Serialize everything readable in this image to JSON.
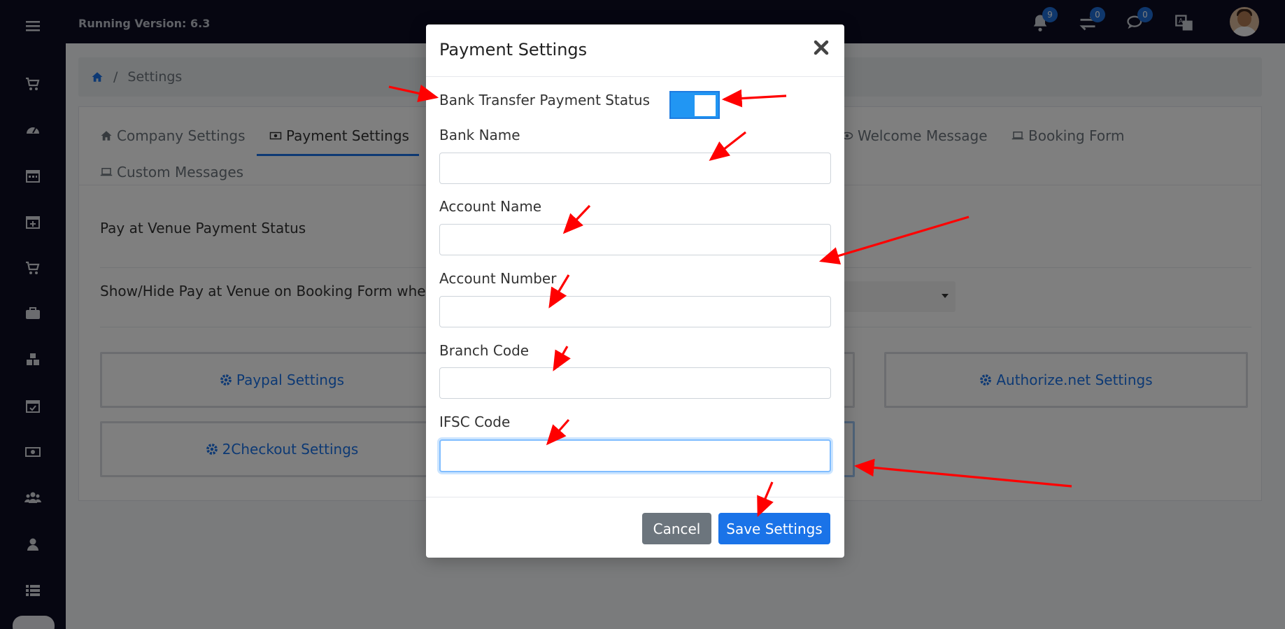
{
  "topbar": {
    "version": "Running Version: 6.3",
    "icons": [
      {
        "name": "notifications-icon",
        "badge": "9"
      },
      {
        "name": "transfer-icon",
        "badge": "0"
      },
      {
        "name": "messages-icon",
        "badge": "0"
      },
      {
        "name": "translate-icon",
        "badge": ""
      }
    ]
  },
  "sidebar": {
    "items": [
      "menu-icon",
      "cart-icon",
      "dashboard-icon",
      "calendar-icon",
      "calendar-plus-icon",
      "cart-icon",
      "briefcase-icon",
      "cubes-icon",
      "calendar-check-icon",
      "money-icon",
      "users-icon",
      "user-icon",
      "list-icon"
    ]
  },
  "breadcrumb": {
    "current": "Settings"
  },
  "tabs": [
    {
      "label": "Company Settings",
      "icon": "home-icon"
    },
    {
      "label": "Payment Settings",
      "icon": "money-icon"
    },
    {
      "label": "Welcome Message",
      "icon": "eye-icon"
    },
    {
      "label": "Booking Form",
      "icon": "laptop-icon"
    },
    {
      "label": "Custom Messages",
      "icon": "laptop-icon"
    }
  ],
  "content": {
    "pay_at_venue_label": "Pay at Venue Payment Status",
    "show_hide_label": "Show/Hide Pay at Venue on Booking Form when a",
    "gateways": {
      "paypal": "Paypal Settings",
      "authorize": "Authorize.net Settings",
      "checkout2": "2Checkout Settings"
    }
  },
  "modal": {
    "title": "Payment Settings",
    "toggle_label": "Bank Transfer Payment Status",
    "toggle_on": true,
    "fields": [
      {
        "label": "Bank Name",
        "value": ""
      },
      {
        "label": "Account Name",
        "value": ""
      },
      {
        "label": "Account Number",
        "value": ""
      },
      {
        "label": "Branch Code",
        "value": ""
      },
      {
        "label": "IFSC Code",
        "value": ""
      }
    ],
    "cancel_label": "Cancel",
    "save_label": "Save Settings"
  },
  "colors": {
    "accent": "#1a73e8",
    "toggle": "#2196f3",
    "annotation": "#ff0000",
    "sidebar": "#0d0d22"
  }
}
